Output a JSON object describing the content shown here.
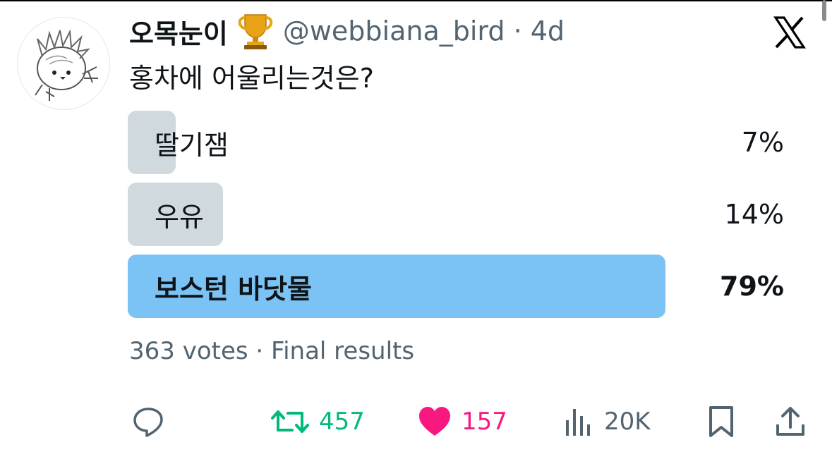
{
  "tweet": {
    "display_name": "오목눈이",
    "handle_and_time": "@webbiana_bird · 4d",
    "text": "홍차에 어울리는것은?"
  },
  "poll": {
    "options": [
      {
        "label": "딸기잼",
        "percent_text": "7%",
        "percent": 7,
        "winner": false
      },
      {
        "label": "우유",
        "percent_text": "14%",
        "percent": 14,
        "winner": false
      },
      {
        "label": "보스턴 바닷물",
        "percent_text": "79%",
        "percent": 79,
        "winner": true
      }
    ],
    "summary": "363 votes · Final results"
  },
  "actions": {
    "reply_icon": "reply-icon",
    "retweet_count": "457",
    "like_count": "157",
    "views_count": "20K",
    "bookmark_icon": "bookmark-icon",
    "share_icon": "share-icon"
  },
  "colors": {
    "retweet": "#00ba7c",
    "like": "#f91880",
    "poll_bar": "#cfd9de",
    "poll_winner_bar": "#7cc3f5",
    "secondary_text": "#536471"
  }
}
